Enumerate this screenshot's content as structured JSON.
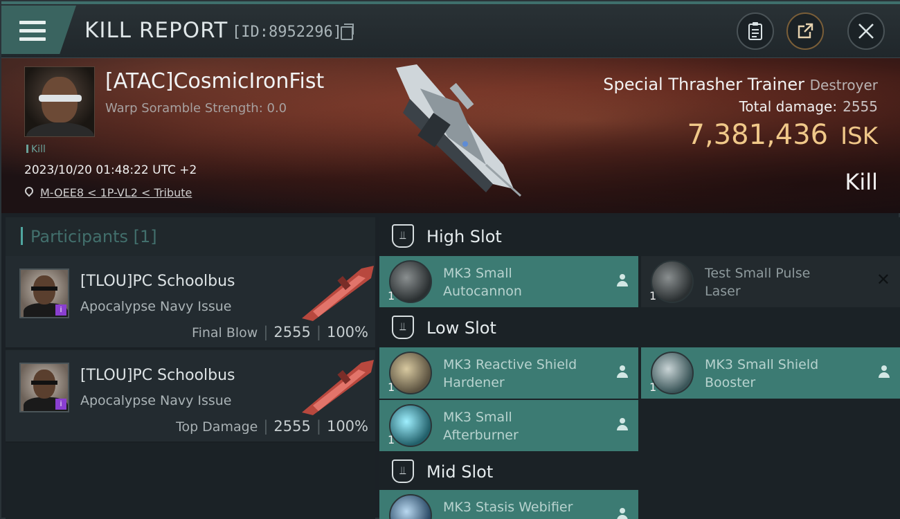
{
  "header": {
    "title": "KILL REPORT",
    "report_id": "[ID:8952296]"
  },
  "victim": {
    "name": "[ATAC]CosmicIronFist",
    "warp_scramble": "Warp Soramble Strength: 0.0",
    "tag": "Kill",
    "datetime": "2023/10/20 01:48:22 UTC +2",
    "location": "M-OEE8 < 1P-VL2 < Tribute",
    "ship_name": "Special Thrasher Trainer",
    "ship_class": "Destroyer",
    "total_damage_label": "Total damage:",
    "total_damage": "2555",
    "isk_value": "7,381,436",
    "isk_unit": "ISK",
    "result": "Kill"
  },
  "participants": {
    "title": "Participants",
    "count": "[1]",
    "rows": [
      {
        "name": "[TLOU]PC Schoolbus",
        "ship": "Apocalypse Navy Issue",
        "label": "Final Blow",
        "damage": "2555",
        "percent": "100%"
      },
      {
        "name": "[TLOU]PC Schoolbus",
        "ship": "Apocalypse Navy Issue",
        "label": "Top Damage",
        "damage": "2555",
        "percent": "100%"
      }
    ]
  },
  "fitting": {
    "high_slot": {
      "title": "High Slot",
      "modules": [
        {
          "name_line1": "MK3 Small",
          "name_line2": "Autocannon",
          "qty": "1"
        },
        {
          "name_line1": "Test Small Pulse",
          "name_line2": "Laser",
          "qty": "1"
        }
      ]
    },
    "low_slot": {
      "title": "Low Slot",
      "modules": [
        {
          "name_line1": "MK3 Reactive Shield",
          "name_line2": "Hardener",
          "qty": "1"
        },
        {
          "name_line1": "MK3 Small Shield",
          "name_line2": "Booster",
          "qty": "1"
        },
        {
          "name_line1": "MK3 Small",
          "name_line2": "Afterburner",
          "qty": "1"
        }
      ]
    },
    "mid_slot": {
      "title": "Mid Slot",
      "modules": [
        {
          "name_line1": "MK3 Stasis Webifier",
          "name_line2": "",
          "qty": ""
        }
      ]
    }
  },
  "icons": {
    "menu": "hamburger-menu-icon",
    "copy": "copy-icon",
    "clipboard": "clipboard-icon",
    "share": "share-icon",
    "close": "close-icon",
    "location": "location-pin-icon",
    "slot": "slot-icon",
    "person": "person-icon"
  },
  "colors": {
    "accent_teal": "#3c7b73",
    "isk_gold": "#f0c889",
    "badge_purple": "#8a3fd0"
  }
}
